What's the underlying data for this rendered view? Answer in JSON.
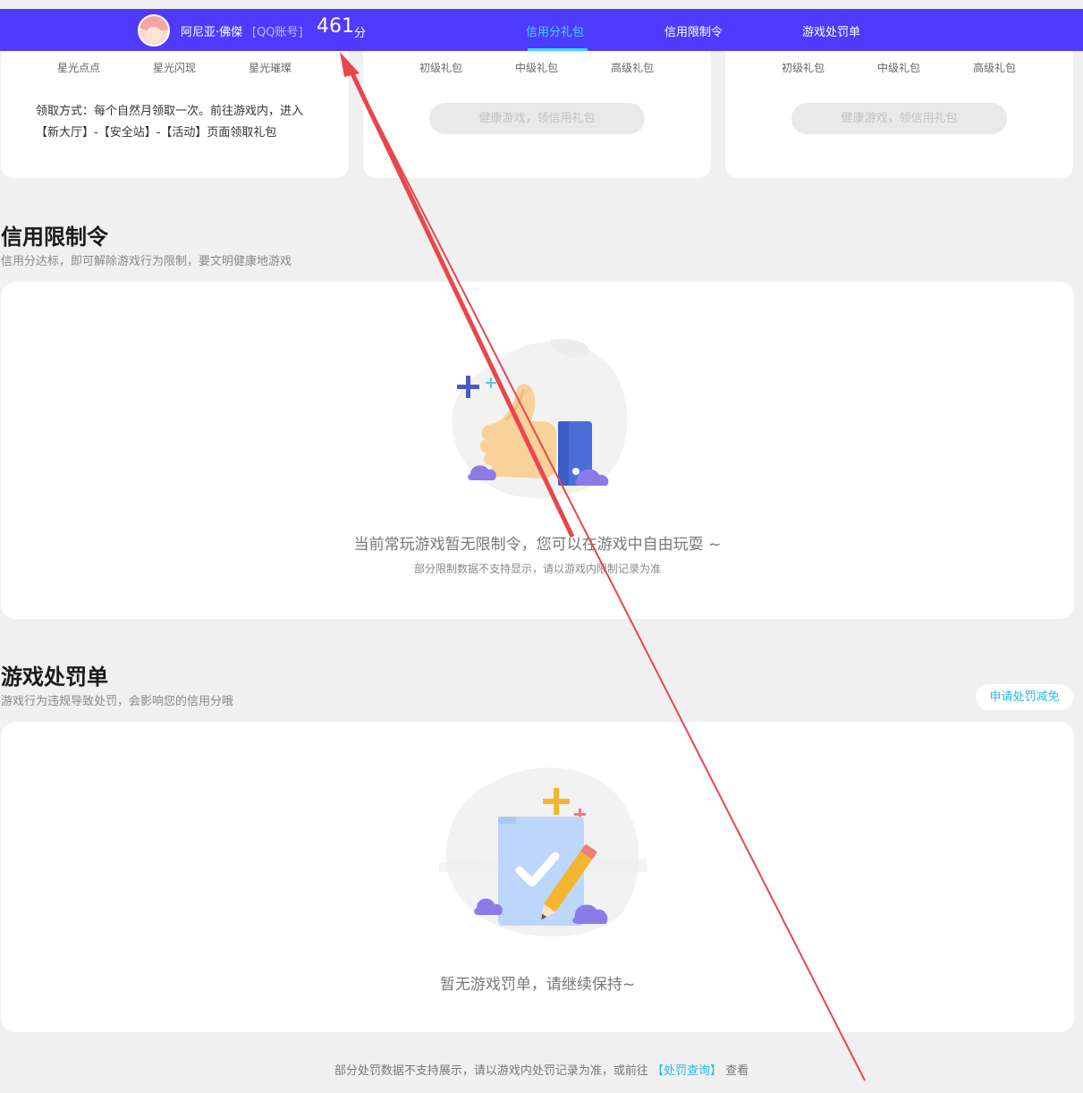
{
  "header": {
    "username": "阿尼亚·佛傑",
    "account_type": "[QQ账号]",
    "score": "461",
    "score_unit": "分",
    "tabs": [
      {
        "label": "信用分礼包",
        "active": true
      },
      {
        "label": "信用限制令",
        "active": false
      },
      {
        "label": "游戏处罚单",
        "active": false
      }
    ]
  },
  "gift_cards": [
    {
      "tiers": [
        "星光点点",
        "星光闪现",
        "星光璀璨"
      ],
      "claim_method": "领取方式：每个自然月领取一次。前往游戏内，进入【新大厅】-【安全站】-【活动】页面领取礼包"
    },
    {
      "tiers": [
        "初级礼包",
        "中级礼包",
        "高级礼包"
      ],
      "button": "健康游戏，领信用礼包"
    },
    {
      "tiers": [
        "初级礼包",
        "中级礼包",
        "高级礼包"
      ],
      "button": "健康游戏，领信用礼包"
    }
  ],
  "restriction": {
    "title": "信用限制令",
    "subtitle": "信用分达标，即可解除游戏行为限制，要文明健康地游戏",
    "empty_main": "当前常玩游戏暂无限制令，您可以在游戏中自由玩耍 ~",
    "empty_sub": "部分限制数据不支持显示，请以游戏内限制记录为准"
  },
  "penalty": {
    "title": "游戏处罚单",
    "subtitle": "游戏行为违规导致处罚，会影响您的信用分哦",
    "appeal_button": "申请处罚减免",
    "empty_main": "暂无游戏罚单，请继续保持~",
    "footer_prefix": "部分处罚数据不支持展示，请以游戏内处罚记录为准，或前往",
    "footer_link": "【处罚查询】",
    "footer_suffix": "查看"
  },
  "icons": {
    "avatar": "anime-avatar",
    "restriction_illustration": "thumbs-up-icon",
    "penalty_illustration": "clipboard-check-icon",
    "annotation": "red-arrow"
  },
  "colors": {
    "header_bg": "#4e3bff",
    "active_tab": "#3ad7ff",
    "link": "#2bb6e8",
    "annotation": "#e8474b"
  }
}
